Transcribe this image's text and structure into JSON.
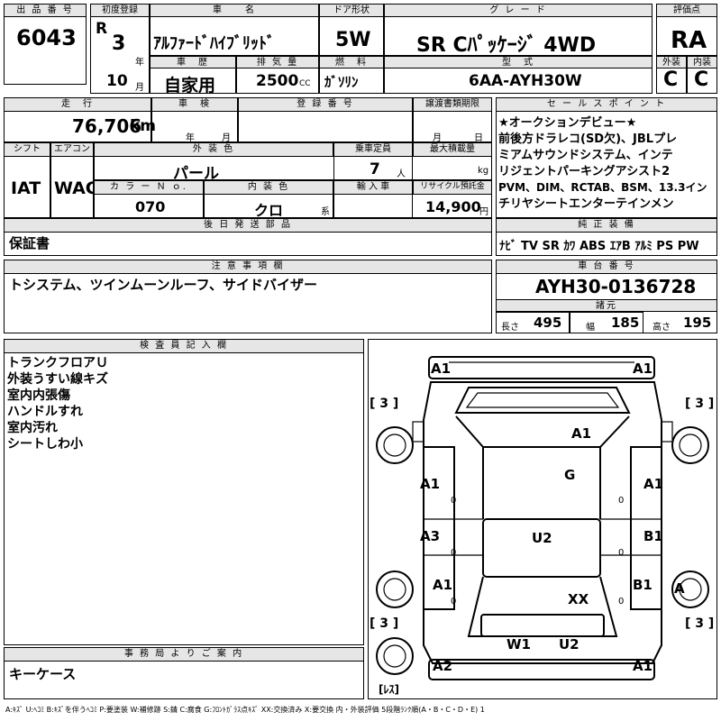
{
  "header": {
    "lot_label": "出 品 番 号",
    "lot_no": "6043",
    "first_reg_label": "初度登録",
    "era": "R",
    "year": "3",
    "year_unit": "年",
    "month": "10",
    "month_unit": "月",
    "name_label": "車　　名",
    "car_name": "ｱﾙﾌｧｰﾄﾞﾊｲﾌﾞﾘｯﾄﾞ",
    "door_label": "ドア形状",
    "door": "5W",
    "grade_label": "グ レ ー ド",
    "grade": "SR Cﾊﾟｯｹｰｼﾞ 4WD",
    "score_label": "評価点",
    "score": "RA",
    "history_label": "車　歴",
    "history": "自家用",
    "displacement_label": "排 気 量",
    "displacement": "2500",
    "displacement_unit": "CC",
    "fuel_label": "燃　料",
    "fuel": "ｶﾞｿﾘﾝ",
    "model_label": "型　式",
    "model": "6AA-AYH30W",
    "ext_label": "外装",
    "ext": "C",
    "int_label": "内装",
    "int": "C"
  },
  "row2": {
    "mileage_label": "走　行",
    "mileage": "76,706",
    "mileage_unit": "km",
    "inspection_label": "車　検",
    "insp_year": "年",
    "insp_month": "月",
    "reg_label": "登 録 番 号",
    "transfer_label": "譲渡書類期限",
    "tr_month": "月",
    "tr_day": "日",
    "shift_label": "シフト",
    "shift": "IAT",
    "ac_label": "エアコン",
    "ac": "WAC",
    "color_label": "外 装 色",
    "color": "パール",
    "capacity_label": "乗車定員",
    "capacity": "7",
    "capacity_unit": "人",
    "load_label": "最大積載量",
    "load_unit": "kg",
    "colorno_label": "カ ラ ー Ｎ ｏ.",
    "colorno": "070",
    "intcolor_label": "内 装 色",
    "intcolor": "クロ",
    "intcolor_unit": "系",
    "import_label": "輸 入 車",
    "recycle_label": "リサイクル預託金",
    "recycle": "14,900",
    "recycle_unit": "円"
  },
  "sales": {
    "label": "セ ー ル ス ポ イ ン ト",
    "lines": [
      "★オークションデビュー★",
      "前後方ドラレコ(SD欠)、JBLプレ",
      "ミアムサウンドシステム、インテ",
      "リジェントパーキングアシスト2",
      "PVM、DIM、RCTAB、BSM、13.3イン",
      "チリヤシートエンターテインメン"
    ]
  },
  "later": {
    "label": "後 日 発 送 部 品",
    "value": "保証書"
  },
  "equip": {
    "label": "純 正 装 備",
    "items": [
      "ﾅﾋﾞ",
      "TV",
      "SR",
      "ｶﾜ",
      "ABS",
      "ｴｱB",
      "ｱﾙﾐ",
      "PS",
      "PW"
    ]
  },
  "caution": {
    "label": "注 意 事 項 欄",
    "value": "トシステム、ツインムーンルーフ、サイドバイザー"
  },
  "chassis": {
    "label": "車 台 番 号",
    "value": "AYH30-0136728",
    "spec_label": "諸元",
    "length_label": "長さ",
    "length": "495",
    "width_label": "幅",
    "width": "185",
    "height_label": "高さ",
    "height": "195"
  },
  "inspector": {
    "label": "検 査 員 記 入 欄",
    "lines": [
      "トランクフロアＵ",
      "外装うすい線キズ",
      "室内内張傷",
      "ハンドルすれ",
      "室内汚れ",
      "シートしわ小"
    ]
  },
  "office": {
    "label": "事 務 局 よ り ご 案 内",
    "value": "キーケース"
  },
  "diagram": {
    "marks": {
      "a1_top_left": "A1",
      "a1_top_right": "A1",
      "a1_hood": "A1",
      "g_windshield": "G",
      "a1_front_left": "A1",
      "a1_front_right": "A1",
      "a3_left": "A3",
      "b1_right": "B1",
      "u2_roof": "U2",
      "a1_rear_left": "A1",
      "b1_rear_right": "B1",
      "xx_rear": "XX",
      "w1_back": "W1",
      "u2_back": "U2",
      "a2_bottom": "A2",
      "a1_bottom": "A1",
      "wheel_a": "A"
    },
    "tire_label": "[ 3 ]",
    "zero": "0",
    "spare_label": "[ﾚｽ]"
  },
  "legend": "A:ｷｽﾞ U:ﾍｺﾐ B:ｷｽﾞを伴うﾍｺﾐ P:要塗装 W:補修跡 S:錆 C:腐食 G:ﾌﾛﾝﾄｶﾞﾗｽ点ｷｽﾞ XX:交換済み X:要交換 内・外装評価 5段階ﾗﾝｸ順(A・B・C・D・E) 1"
}
